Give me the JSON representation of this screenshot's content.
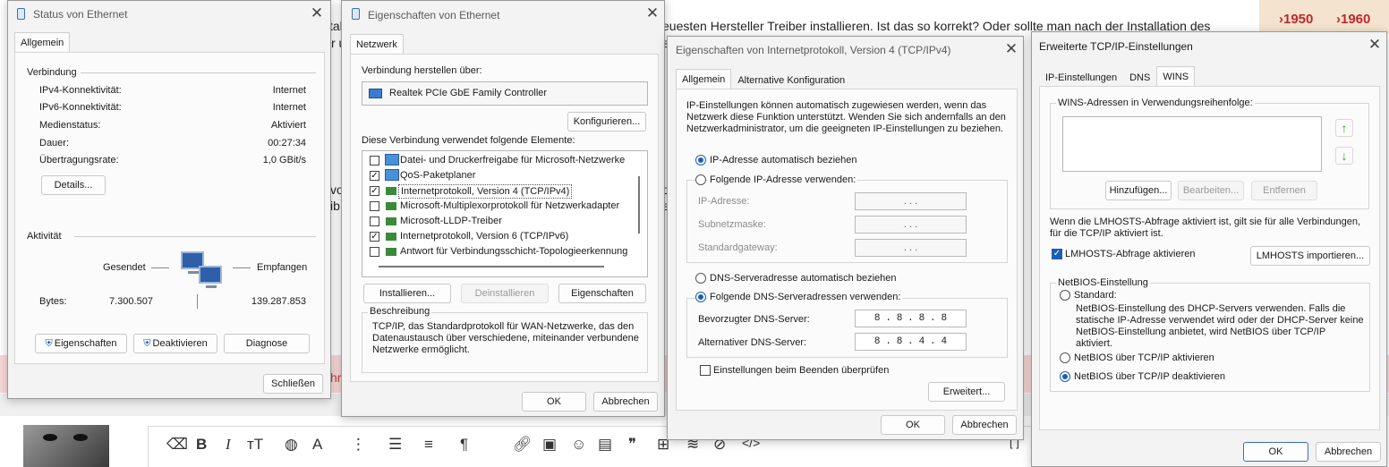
{
  "background": {
    "text_line1": "euesten Hersteller Treiber installieren. Ist das so korrekt? Oder sollte man nach der Installation des",
    "text_frag_a": "tal",
    "text_frag_b": "r u",
    "text_frag_c": "vo",
    "text_frag_d": "ib",
    "text_frag_e": "hri",
    "year_1": "›1950",
    "year_2": "›1960",
    "toolbar_icons": [
      "eraser",
      "B",
      "I",
      "tT",
      "palette",
      "A",
      "more",
      "list",
      "align",
      "paragraph",
      "link",
      "image",
      "emoji",
      "media",
      "quote",
      "table",
      "hide",
      "no-preview",
      "code",
      "brackets"
    ],
    "bold_glyph": "B",
    "italic_glyph": "I",
    "tt_glyph": "тT",
    "a_glyph": "A",
    "para_glyph": "¶",
    "quote_glyph": "❞",
    "code_glyph": "</>",
    "bracket_glyph": "[ ]"
  },
  "status_window": {
    "title": "Status von Ethernet",
    "tab": "Allgemein",
    "connection_group": "Verbindung",
    "rows": [
      {
        "label": "IPv4-Konnektivität:",
        "value": "Internet"
      },
      {
        "label": "IPv6-Konnektivität:",
        "value": "Internet"
      },
      {
        "label": "Medienstatus:",
        "value": "Aktiviert"
      },
      {
        "label": "Dauer:",
        "value": "00:27:34"
      },
      {
        "label": "Übertragungsrate:",
        "value": "1,0 GBit/s"
      }
    ],
    "details_button": "Details...",
    "activity_group": "Aktivität",
    "sent_label": "Gesendet",
    "received_label": "Empfangen",
    "bytes_label": "Bytes:",
    "bytes_sent": "7.300.507",
    "bytes_received": "139.287.853",
    "properties_button": "Eigenschaften",
    "deactivate_button": "Deaktivieren",
    "diagnose_button": "Diagnose",
    "close_button": "Schließen"
  },
  "props_window": {
    "title": "Eigenschaften von Ethernet",
    "tab": "Netzwerk",
    "connect_via_label": "Verbindung herstellen über:",
    "adapter": "Realtek PCIe GbE Family Controller",
    "configure_button": "Konfigurieren...",
    "elements_label": "Diese Verbindung verwendet folgende Elemente:",
    "items": [
      {
        "label": "Datei- und Druckerfreigabe für Microsoft-Netzwerke",
        "checked": false,
        "icon": "network-client-icon"
      },
      {
        "label": "QoS-Paketplaner",
        "checked": true,
        "icon": "network-client-icon"
      },
      {
        "label": "Internetprotokoll, Version 4 (TCP/IPv4)",
        "checked": true,
        "icon": "protocol-icon",
        "selected": true
      },
      {
        "label": "Microsoft-Multiplexorprotokoll für Netzwerkadapter",
        "checked": false,
        "icon": "protocol-icon"
      },
      {
        "label": "Microsoft-LLDP-Treiber",
        "checked": false,
        "icon": "protocol-icon"
      },
      {
        "label": "Internetprotokoll, Version 6 (TCP/IPv6)",
        "checked": true,
        "icon": "protocol-icon"
      },
      {
        "label": "Antwort für Verbindungsschicht-Topologieerkennung",
        "checked": false,
        "icon": "protocol-icon"
      }
    ],
    "install_button": "Installieren...",
    "uninstall_button": "Deinstallieren",
    "properties_button": "Eigenschaften",
    "description_group": "Beschreibung",
    "description": "TCP/IP, das Standardprotokoll für WAN-Netzwerke, das den Datenaustausch über verschiedene, miteinander verbundene Netzwerke ermöglicht.",
    "ok_button": "OK",
    "cancel_button": "Abbrechen"
  },
  "ipv4_window": {
    "title": "Eigenschaften von Internetprotokoll, Version 4 (TCP/IPv4)",
    "tab_general": "Allgemein",
    "tab_alt": "Alternative Konfiguration",
    "intro": "IP-Einstellungen können automatisch zugewiesen werden, wenn das Netzwerk diese Funktion unterstützt. Wenden Sie sich andernfalls an den Netzwerkadministrator, um die geeigneten IP-Einstellungen zu beziehen.",
    "ip_auto": "IP-Adresse automatisch beziehen",
    "ip_manual": "Folgende IP-Adresse verwenden:",
    "ip_label": "IP-Adresse:",
    "subnet_label": "Subnetzmaske:",
    "gateway_label": "Standardgateway:",
    "empty_ip": ".       .       .",
    "dns_auto": "DNS-Serveradresse automatisch beziehen",
    "dns_manual": "Folgende DNS-Serveradressen verwenden:",
    "preferred_dns_label": "Bevorzugter DNS-Server:",
    "preferred_dns": [
      "8",
      "8",
      "8",
      "8"
    ],
    "alternate_dns_label": "Alternativer DNS-Server:",
    "alternate_dns": [
      "8",
      "8",
      "4",
      "4"
    ],
    "validate_label": "Einstellungen beim Beenden überprüfen",
    "advanced_button": "Erweitert...",
    "ok_button": "OK",
    "cancel_button": "Abbrechen"
  },
  "advanced_window": {
    "title": "Erweiterte TCP/IP-Einstellungen",
    "tabs": [
      "IP-Einstellungen",
      "DNS",
      "WINS"
    ],
    "wins_group": "WINS-Adressen in Verwendungsreihenfolge:",
    "add_button": "Hinzufügen...",
    "edit_button": "Bearbeiten...",
    "remove_button": "Entfernen",
    "lmhosts_info": "Wenn die LMHOSTS-Abfrage aktiviert ist, gilt sie für alle Verbindungen, für die TCP/IP aktiviert ist.",
    "lmhosts_check": "LMHOSTS-Abfrage aktivieren",
    "lmhosts_import": "LMHOSTS importieren...",
    "netbios_group": "NetBIOS-Einstellung",
    "netbios_default": "Standard:",
    "netbios_default_desc": "NetBIOS-Einstellung des DHCP-Servers verwenden. Falls die statische IP-Adresse verwendet wird oder der DHCP-Server keine NetBIOS-Einstellung anbietet, wird NetBIOS über TCP/IP aktiviert.",
    "netbios_enable": "NetBIOS über TCP/IP aktivieren",
    "netbios_disable": "NetBIOS über TCP/IP deaktivieren",
    "ok_button": "OK",
    "cancel_button": "Abbrechen"
  },
  "colors": {
    "accent": "#1b5fb5",
    "window_bg": "#f3f3f3",
    "panel_bg": "#fbfbfb"
  }
}
